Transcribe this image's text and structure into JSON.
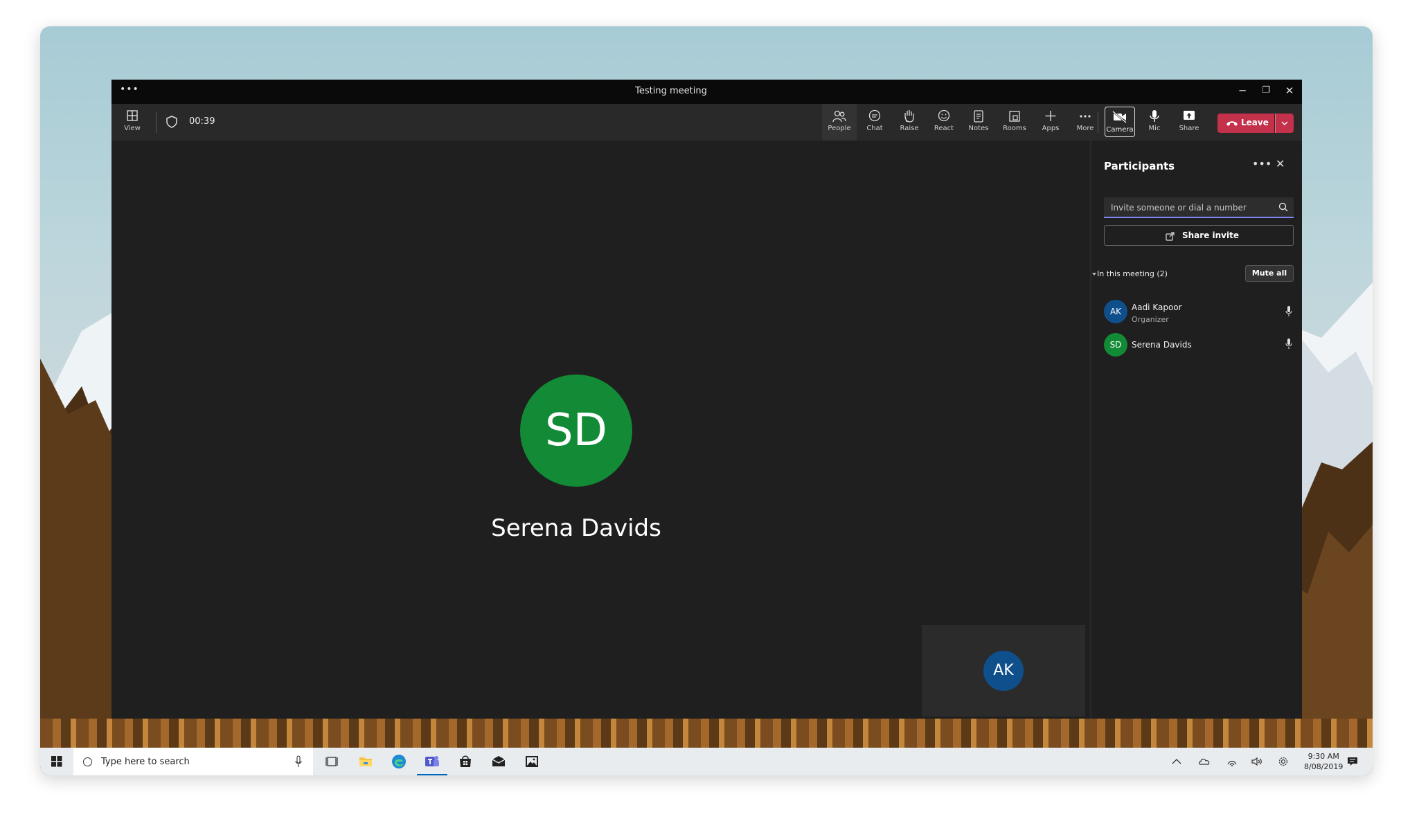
{
  "window": {
    "title": "Testing meeting",
    "menu_dots": "•••",
    "minimize": "─",
    "restore": "❐",
    "close": "✕"
  },
  "toolbar": {
    "view_label": "View",
    "timer": "00:39",
    "people_label": "People",
    "chat_label": "Chat",
    "raise_label": "Raise",
    "react_label": "React",
    "notes_label": "Notes",
    "rooms_label": "Rooms",
    "apps_label": "Apps",
    "more_label": "More",
    "camera_label": "Camera",
    "mic_label": "Mic",
    "share_label": "Share",
    "leave_label": "Leave"
  },
  "stage": {
    "main_initials": "SD",
    "main_name": "Serena Davids",
    "main_color": "#138a36",
    "self_initials": "AK",
    "self_color": "#0f4f8c"
  },
  "participants_panel": {
    "title": "Participants",
    "more": "•••",
    "close": "✕",
    "invite_placeholder": "Invite someone or dial a number",
    "share_invite": "Share invite",
    "meeting_header": "In this meeting (2)",
    "mute_all": "Mute all",
    "people": [
      {
        "initials": "AK",
        "name": "Aadi Kapoor",
        "role": "Organizer",
        "color": "#0f4f8c"
      },
      {
        "initials": "SD",
        "name": "Serena Davids",
        "role": "",
        "color": "#138a36"
      }
    ]
  },
  "taskbar": {
    "search_placeholder": "Type here to search",
    "time": "9:30 AM",
    "date": "8/08/2019"
  },
  "colors": {
    "accent": "#7f85f5",
    "leave": "#c4314b",
    "taskbar_active": "#0067c0"
  }
}
